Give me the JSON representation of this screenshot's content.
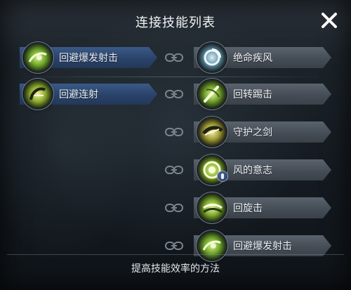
{
  "header": {
    "title": "连接技能列表"
  },
  "footer": {
    "label": "提高技能效率的方法"
  },
  "left_skills": [
    {
      "label": "回避爆发射击",
      "icon": "evasive-burst-shot-icon",
      "color": "#7fbf3a"
    },
    {
      "label": "回避连射",
      "icon": "evasive-rapid-fire-icon",
      "color": "#a6c43a"
    }
  ],
  "right_skills": [
    {
      "label": "绝命疾风",
      "icon": "deadly-gale-icon",
      "color": "#7aa6b8"
    },
    {
      "label": "回转踢击",
      "icon": "spinning-kick-icon",
      "color": "#8fbf3a"
    },
    {
      "label": "守护之剑",
      "icon": "guardian-sword-icon",
      "color": "#b9c23e"
    },
    {
      "label": "风的意志",
      "icon": "will-of-wind-icon",
      "color": "#a8c83a"
    },
    {
      "label": "回旋击",
      "icon": "whirl-strike-icon",
      "color": "#9fc63a"
    },
    {
      "label": "回避爆发射击",
      "icon": "evasive-burst-shot-icon",
      "color": "#7fbf3a"
    }
  ],
  "colors": {
    "left_bar": "#2a436a",
    "right_bar": "#454d56",
    "accent_edge": "#7fa9d8"
  }
}
